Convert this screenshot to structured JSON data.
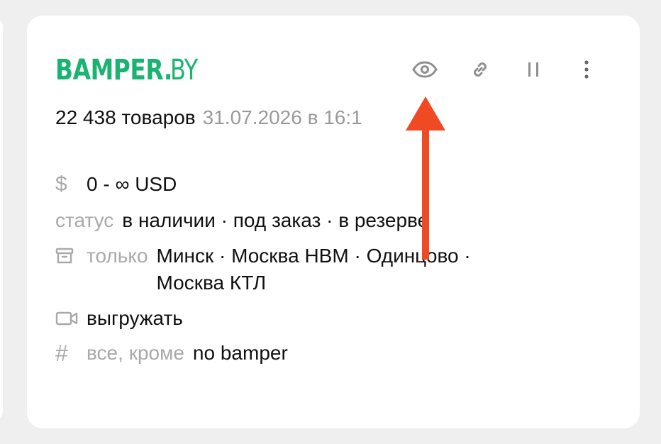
{
  "card": {
    "logo": {
      "main": "BAMPER.",
      "tld": "BY"
    },
    "toolbar": {
      "icons": [
        "eye-icon",
        "link-icon",
        "pause-icon",
        "more-vertical-icon"
      ]
    },
    "summary": {
      "count": "22 438 товаров",
      "updated": "31.07.2026 в 16:1"
    },
    "price": {
      "icon": "dollar-icon",
      "value": "0 - ∞ USD"
    },
    "status": {
      "label": "статус",
      "value": "в наличии · под заказ · в резерве"
    },
    "stores": {
      "icon": "archive-box-icon",
      "label": "только",
      "value": "Минск · Москва НВМ · Одинцово · Москва КТЛ"
    },
    "video": {
      "icon": "video-camera-icon",
      "value": "выгружать"
    },
    "tags": {
      "icon": "hash-icon",
      "label": "все, кроме",
      "value": "no bamper"
    }
  },
  "colors": {
    "brand": "#1ab372",
    "muted_text": "#9a9a9a",
    "icon_gray": "#8f8f8f",
    "annotation_arrow": "#f04a25",
    "background": "#efefef",
    "card": "#ffffff"
  }
}
